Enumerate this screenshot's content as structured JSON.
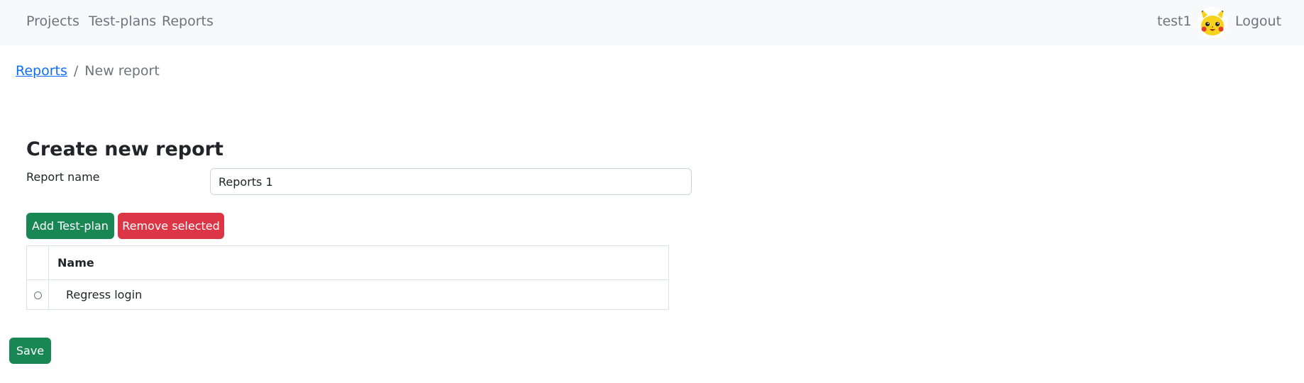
{
  "nav": {
    "links": [
      "Projects",
      "Test-plans",
      "Reports"
    ],
    "user": "test1",
    "logout_label": "Logout"
  },
  "breadcrumb": {
    "parent": "Reports",
    "separator": "/",
    "current": "New report"
  },
  "form": {
    "title": "Create new report",
    "name_label": "Report name",
    "name_value": "Reports 1"
  },
  "actions": {
    "add_label": "Add Test-plan",
    "remove_label": "Remove selected"
  },
  "table": {
    "header_name": "Name",
    "rows": [
      {
        "name": "Regress login"
      }
    ]
  },
  "save_label": "Save",
  "colors": {
    "success": "#198754",
    "danger": "#dc3545",
    "link": "#0d6efd",
    "navbar_bg": "#f8f9fa"
  },
  "icons": {
    "avatar": "pikachu-avatar-icon"
  }
}
